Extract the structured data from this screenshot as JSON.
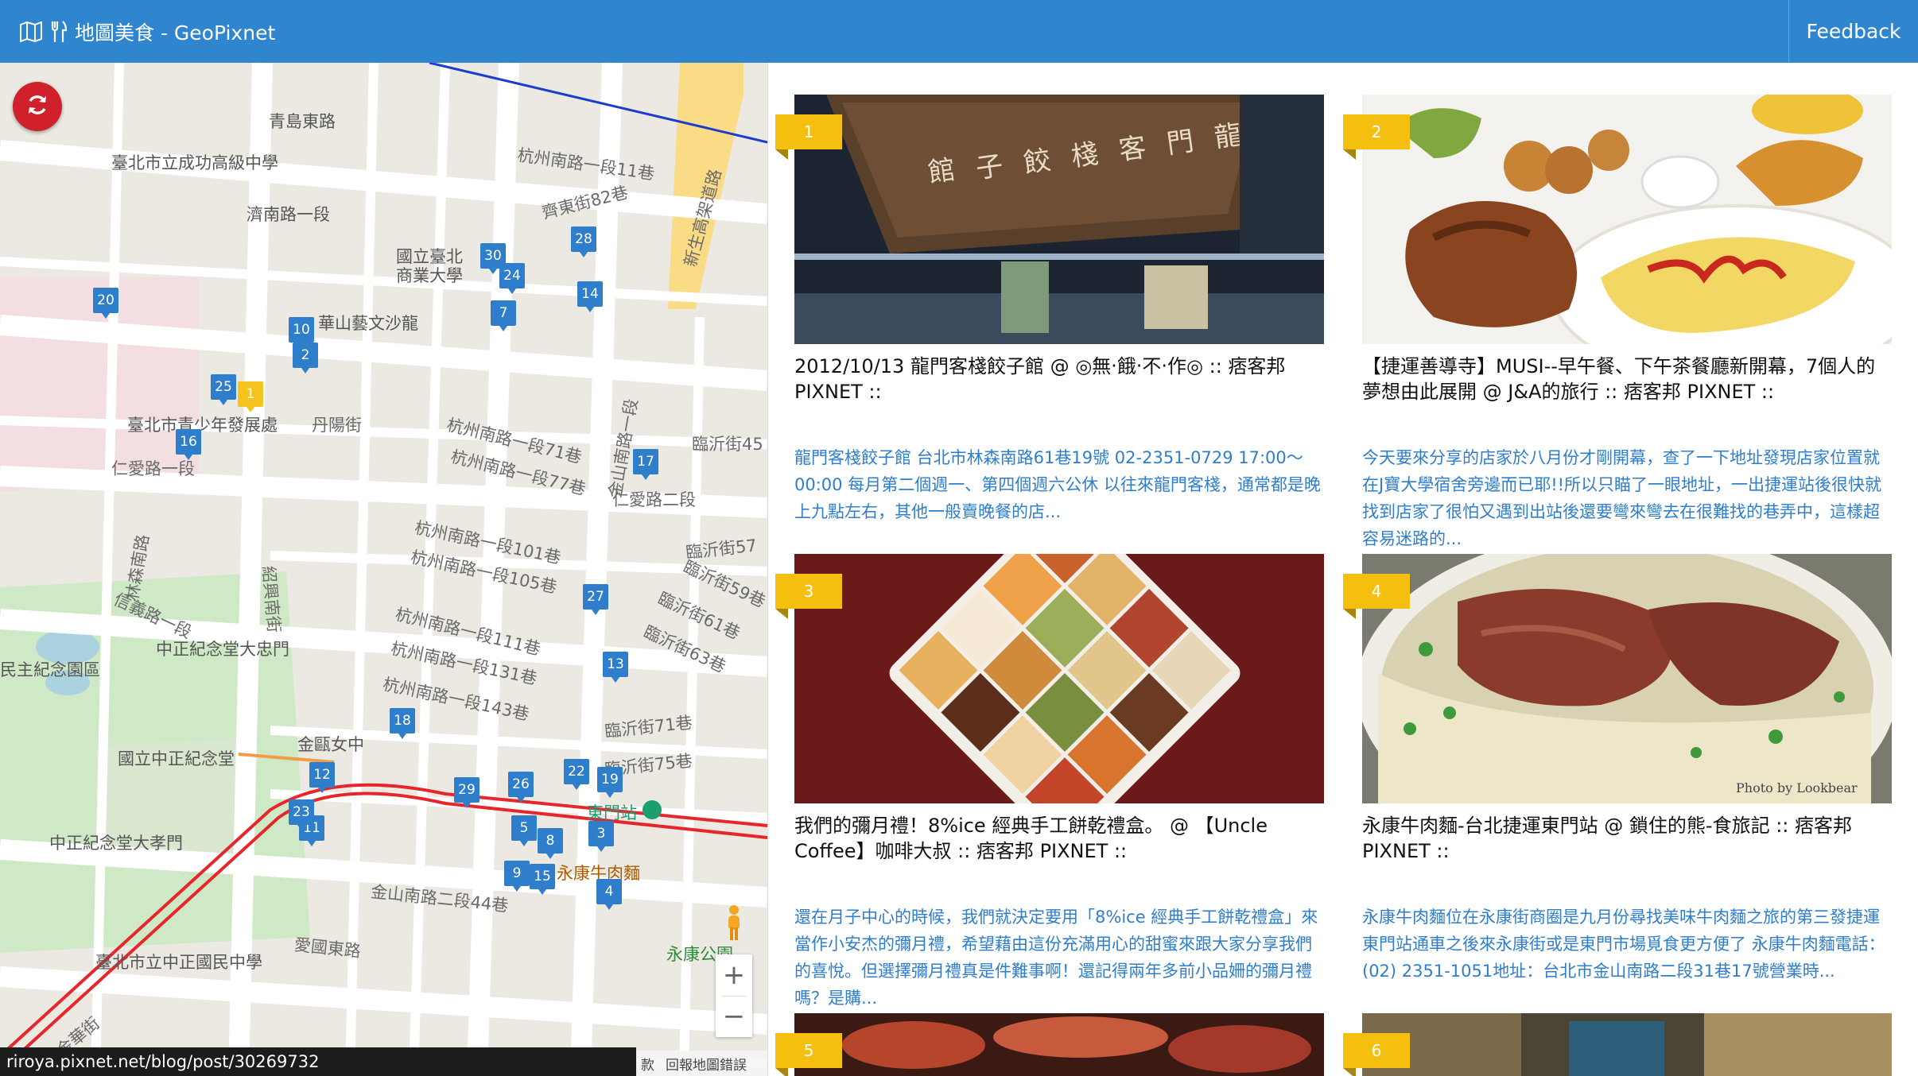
{
  "header": {
    "title": "地圖美食 - GeoPixnet",
    "feedback_label": "Feedback"
  },
  "map": {
    "markers": [
      {
        "label": "1",
        "active": true
      },
      {
        "label": "2"
      },
      {
        "label": "3"
      },
      {
        "label": "4"
      },
      {
        "label": "5"
      },
      {
        "label": "7"
      },
      {
        "label": "8"
      },
      {
        "label": "9"
      },
      {
        "label": "10"
      },
      {
        "label": "11"
      },
      {
        "label": "12"
      },
      {
        "label": "13"
      },
      {
        "label": "14"
      },
      {
        "label": "15"
      },
      {
        "label": "16"
      },
      {
        "label": "17"
      },
      {
        "label": "18"
      },
      {
        "label": "19"
      },
      {
        "label": "20"
      },
      {
        "label": "22"
      },
      {
        "label": "23"
      },
      {
        "label": "24"
      },
      {
        "label": "25"
      },
      {
        "label": "26"
      },
      {
        "label": "27"
      },
      {
        "label": "28"
      },
      {
        "label": "29"
      },
      {
        "label": "30"
      }
    ],
    "labels": [
      "青島東路",
      "臺北市立成功高級中學",
      "濟南路一段",
      "杭州南路一段11巷",
      "齊東街82巷",
      "新生高架道路",
      "國立臺北商業大學",
      "華山藝文沙龍",
      "臺北市青少年發展處",
      "丹陽街",
      "仁愛路一段",
      "仁愛路二段",
      "林森南路",
      "紹興南街",
      "杭州南路一段71巷",
      "杭州南路一段77巷",
      "金山南路一段",
      "臨沂街45",
      "杭州南路一段101巷",
      "杭州南路一段105巷",
      "杭州南路一段111巷",
      "杭州南路一段131巷",
      "杭州南路一段143巷",
      "信義路一段",
      "中正紀念堂大忠門",
      "民主紀念園區",
      "國立中正紀念堂",
      "金甌女中",
      "中正紀念堂大孝門",
      "臨沂街71巷",
      "臨沂街75巷",
      "東門站",
      "永康牛肉麵",
      "金山南路二段44巷",
      "愛國東路",
      "臺北市立中正國民中學",
      "金華街",
      "永康公園",
      "臨沂街57",
      "臨沂街59巷",
      "臨沂街61巷",
      "臨沂街63巷"
    ],
    "footer_terms": "款",
    "footer_report": "回報地圖錯誤",
    "status_url": "riroya.pixnet.net/blog/post/30269732",
    "zoom_in": "+",
    "zoom_out": "−"
  },
  "posts": [
    {
      "rank": "1",
      "title": "2012/10/13 龍門客棧餃子館 @ ◎無‧餓‧不‧作◎ :: 痞客邦 PIXNET ::",
      "excerpt": "龍門客棧餃子館 台北市林森南路61巷19號 02-2351-0729 17:00～00:00 每月第二個週一、第四個週六公休 以往來龍門客棧，通常都是晚上九點左右，其他一般賣晚餐的店..."
    },
    {
      "rank": "2",
      "title": "【捷運善導寺】MUSI--早午餐、下午茶餐廳新開幕，7個人的夢想由此展開 @ J&A的旅行 :: 痞客邦 PIXNET ::",
      "excerpt": "今天要來分享的店家於八月份才剛開幕，查了一下地址發現店家位置就在J寶大學宿舍旁邊而已耶!!所以只瞄了一眼地址，一出捷運站後很快就找到店家了很怕又遇到出站後還要彎來彎去在很難找的巷弄中，這樣超容易迷路的..."
    },
    {
      "rank": "3",
      "title": "我們的彌月禮！8%ice 經典手工餅乾禮盒。 @ 【Uncle Coffee】咖啡大叔 :: 痞客邦 PIXNET ::",
      "excerpt": "還在月子中心的時候，我們就決定要用「8%ice 經典手工餅乾禮盒」來當作小安杰的彌月禮，希望藉由這份充滿用心的甜蜜來跟大家分享我們的喜悅。但選擇彌月禮真是件難事啊！還記得兩年多前小品姍的彌月禮嗎？是購..."
    },
    {
      "rank": "4",
      "title": "永康牛肉麵-台北捷運東門站 @ 鎖住的熊-食旅記 :: 痞客邦 PIXNET ::",
      "excerpt": "永康牛肉麵位在永康街商圈是九月份尋找美味牛肉麵之旅的第三發捷運東門站通車之後來永康街或是東門市場覓食更方便了 永康牛肉麵電話：(02) 2351-1051地址：台北市金山南路二段31巷17號營業時..."
    },
    {
      "rank": "5",
      "title": "",
      "excerpt": ""
    },
    {
      "rank": "6",
      "title": "",
      "excerpt": ""
    }
  ],
  "photo_watermark": "Photo by Lookbear",
  "colors": {
    "header": "#2f86cf",
    "marker": "#2f7ecb",
    "marker_active": "#f6c21c",
    "ribbon": "#f5bf10",
    "refresh": "#d0202b",
    "excerpt": "#2f7ecb"
  }
}
